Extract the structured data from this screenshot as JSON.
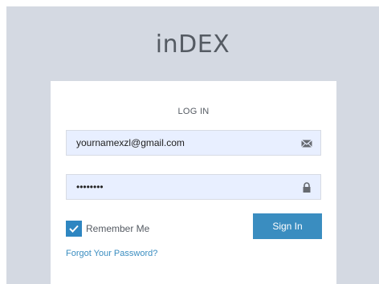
{
  "brand": {
    "title": "inDEX"
  },
  "login": {
    "heading": "LOG IN",
    "email_value": "yournamexzl@gmail.com",
    "password_value": "password",
    "email_icon": "envelope-icon",
    "password_icon": "lock-icon",
    "remember_label": "Remember Me",
    "remember_checked": true,
    "signin_label": "Sign In",
    "forgot_label": "Forgot Your Password?"
  },
  "colors": {
    "background": "#d4d9e2",
    "card": "#ffffff",
    "input_fill": "#e8efff",
    "accent": "#3a8dc0",
    "text": "#555b63"
  }
}
